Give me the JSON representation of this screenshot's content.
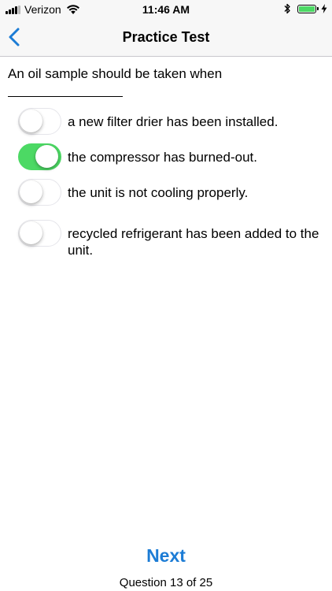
{
  "status_bar": {
    "carrier": "Verizon",
    "time": "11:46 AM",
    "signal_bars": 4,
    "signal_bars_total": 5,
    "battery_level": 1.0,
    "battery_color": "#4cd964",
    "icons": [
      "signal-icon",
      "wifi-icon",
      "bluetooth-icon",
      "battery-icon",
      "charging-icon"
    ]
  },
  "nav": {
    "title": "Practice Test",
    "back_icon": "chevron-left-icon",
    "accent_color": "#1c7cd5"
  },
  "question": {
    "text": "An oil sample should be taken when"
  },
  "options": [
    {
      "label": "a new filter drier has been installed.",
      "selected": false
    },
    {
      "label": "the compressor has burned-out.",
      "selected": true
    },
    {
      "label": "the unit is not cooling properly.",
      "selected": false
    },
    {
      "label": "recycled refrigerant has been added to the unit.",
      "selected": false
    }
  ],
  "footer": {
    "next_label": "Next",
    "progress_text": "Question 13 of 25",
    "current_question": 13,
    "total_questions": 25
  }
}
